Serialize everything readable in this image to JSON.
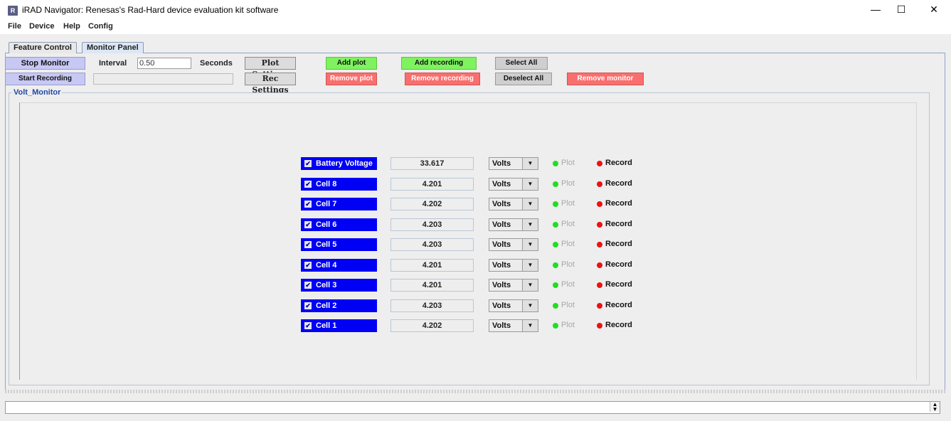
{
  "window": {
    "title": "iRAD Navigator: Renesas's Rad-Hard device evaluation kit software",
    "icon_letter": "R",
    "minimize_glyph": "—",
    "maximize_glyph": "☐",
    "close_glyph": "✕"
  },
  "menu": [
    "File",
    "Device",
    "Help",
    "Config"
  ],
  "tabs": [
    {
      "label": "Feature Control",
      "active": false
    },
    {
      "label": "Monitor Panel",
      "active": true
    }
  ],
  "toolbar": {
    "stop_monitor": "Stop Monitor",
    "start_recording": "Start Recording",
    "interval_label": "Interval",
    "interval_value": "0.50",
    "seconds_label": "Seconds",
    "plot_settings": "Plot Settings",
    "rec_settings": "Rec Settings",
    "add_plot": "Add plot",
    "remove_plot": "Remove plot",
    "add_recording": "Add recording",
    "remove_recording": "Remove recording",
    "select_all": "Select All",
    "deselect_all": "Deselect All",
    "remove_monitor": "Remove monitor"
  },
  "group": {
    "title": "Volt_Monitor"
  },
  "monitors": [
    {
      "name": "Battery Voltage",
      "value": "33.617",
      "unit": "Volts",
      "plot": "Plot",
      "record": "Record"
    },
    {
      "name": "Cell 8",
      "value": "4.201",
      "unit": "Volts",
      "plot": "Plot",
      "record": "Record"
    },
    {
      "name": "Cell 7",
      "value": "4.202",
      "unit": "Volts",
      "plot": "Plot",
      "record": "Record"
    },
    {
      "name": "Cell 6",
      "value": "4.203",
      "unit": "Volts",
      "plot": "Plot",
      "record": "Record"
    },
    {
      "name": "Cell 5",
      "value": "4.203",
      "unit": "Volts",
      "plot": "Plot",
      "record": "Record"
    },
    {
      "name": "Cell 4",
      "value": "4.201",
      "unit": "Volts",
      "plot": "Plot",
      "record": "Record"
    },
    {
      "name": "Cell 3",
      "value": "4.201",
      "unit": "Volts",
      "plot": "Plot",
      "record": "Record"
    },
    {
      "name": "Cell 2",
      "value": "4.203",
      "unit": "Volts",
      "plot": "Plot",
      "record": "Record"
    },
    {
      "name": "Cell 1",
      "value": "4.202",
      "unit": "Volts",
      "plot": "Plot",
      "record": "Record"
    }
  ],
  "colors": {
    "monitor_checkbox_bg": "#0000f5",
    "plot_dot": "#22dd22",
    "record_dot": "#ee1111",
    "add_button": "#7ff25f",
    "remove_button": "#f96f6e",
    "group_title": "#2249a4"
  }
}
